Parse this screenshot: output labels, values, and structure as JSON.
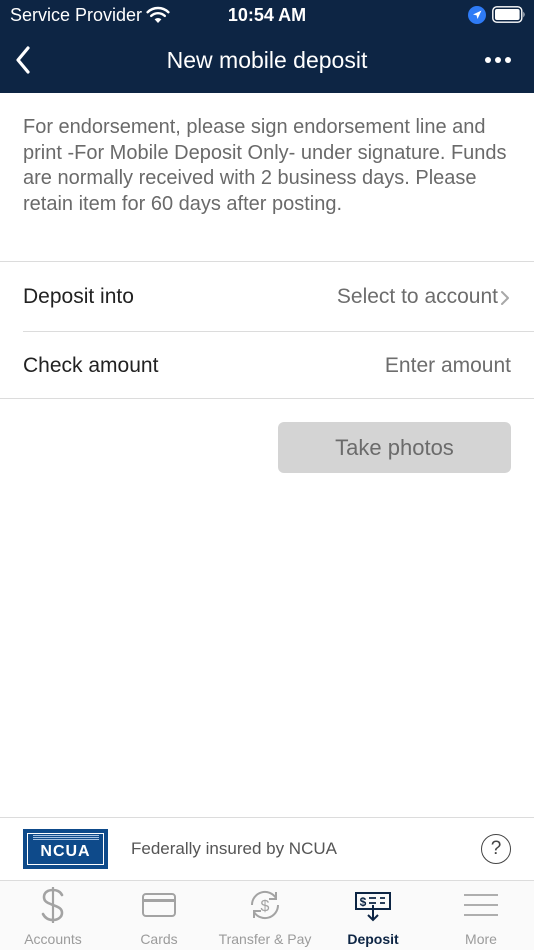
{
  "status_bar": {
    "provider": "Service Provider",
    "time": "10:54 AM"
  },
  "nav": {
    "title": "New mobile deposit"
  },
  "notice": "For endorsement, please sign endorsement line and print -For Mobile Deposit Only- under signature. Funds are normally received with 2 business days. Please retain item for 60 days after posting.",
  "form": {
    "deposit_label": "Deposit into",
    "deposit_value": "Select to account",
    "amount_label": "Check amount",
    "amount_placeholder": "Enter amount"
  },
  "take_photos_label": "Take photos",
  "footer": {
    "logo_text": "NCUA",
    "insured_text": "Federally insured by NCUA",
    "help_glyph": "?"
  },
  "tabs": [
    {
      "label": "Accounts",
      "icon": "dollar-icon",
      "active": false
    },
    {
      "label": "Cards",
      "icon": "card-icon",
      "active": false
    },
    {
      "label": "Transfer & Pay",
      "icon": "transfer-icon",
      "active": false
    },
    {
      "label": "Deposit",
      "icon": "deposit-check-icon",
      "active": true
    },
    {
      "label": "More",
      "icon": "menu-icon",
      "active": false
    }
  ],
  "colors": {
    "header_bg": "#0d2544",
    "active_tab": "#0d2544",
    "inactive_tab": "#9b9b9b",
    "button_disabled_bg": "#d4d4d4",
    "ncua_blue": "#0e4a8a"
  }
}
